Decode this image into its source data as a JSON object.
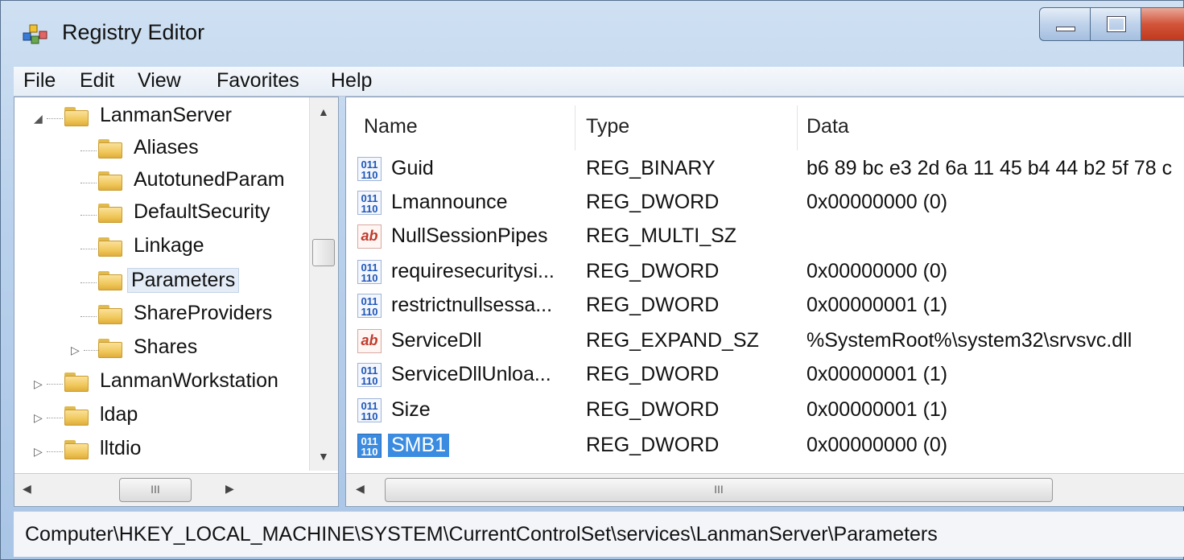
{
  "window": {
    "title": "Registry Editor"
  },
  "menu": [
    "File",
    "Edit",
    "View",
    "Favorites",
    "Help"
  ],
  "tree": {
    "items": [
      {
        "label": "LanmanServer",
        "expanded": true
      },
      {
        "label": "Aliases"
      },
      {
        "label": "AutotunedParam"
      },
      {
        "label": "DefaultSecurity"
      },
      {
        "label": "Linkage"
      },
      {
        "label": "Parameters",
        "selected": true
      },
      {
        "label": "ShareProviders"
      },
      {
        "label": "Shares",
        "expandable": true
      },
      {
        "label": "LanmanWorkstation",
        "expandable": true
      },
      {
        "label": "ldap",
        "expandable": true
      },
      {
        "label": "lltdio",
        "expandable": true
      }
    ],
    "hscroll_thumb_label": "III"
  },
  "list": {
    "columns": [
      "Name",
      "Type",
      "Data"
    ],
    "rows": [
      {
        "icon": "binary-value-icon",
        "name": "Guid",
        "type": "REG_BINARY",
        "data": "b6 89 bc e3 2d 6a 11 45 b4 44 b2 5f 78 c"
      },
      {
        "icon": "binary-value-icon",
        "name": "Lmannounce",
        "type": "REG_DWORD",
        "data": "0x00000000 (0)"
      },
      {
        "icon": "string-value-icon",
        "name": "NullSessionPipes",
        "type": "REG_MULTI_SZ",
        "data": ""
      },
      {
        "icon": "binary-value-icon",
        "name": "requiresecuritysi...",
        "type": "REG_DWORD",
        "data": "0x00000000 (0)"
      },
      {
        "icon": "binary-value-icon",
        "name": "restrictnullsessa...",
        "type": "REG_DWORD",
        "data": "0x00000001 (1)"
      },
      {
        "icon": "string-value-icon",
        "name": "ServiceDll",
        "type": "REG_EXPAND_SZ",
        "data": "%SystemRoot%\\system32\\srvsvc.dll"
      },
      {
        "icon": "binary-value-icon",
        "name": "ServiceDllUnloa...",
        "type": "REG_DWORD",
        "data": "0x00000001 (1)"
      },
      {
        "icon": "binary-value-icon",
        "name": "Size",
        "type": "REG_DWORD",
        "data": "0x00000001 (1)"
      },
      {
        "icon": "binary-value-icon",
        "name": "SMB1",
        "type": "REG_DWORD",
        "data": "0x00000000 (0)",
        "selected": true
      }
    ],
    "hscroll_thumb_label": "III"
  },
  "status": {
    "path": "Computer\\HKEY_LOCAL_MACHINE\\SYSTEM\\CurrentControlSet\\services\\LanmanServer\\Parameters"
  },
  "icons": {
    "binary_glyph": "011\n110",
    "string_glyph": "ab"
  }
}
